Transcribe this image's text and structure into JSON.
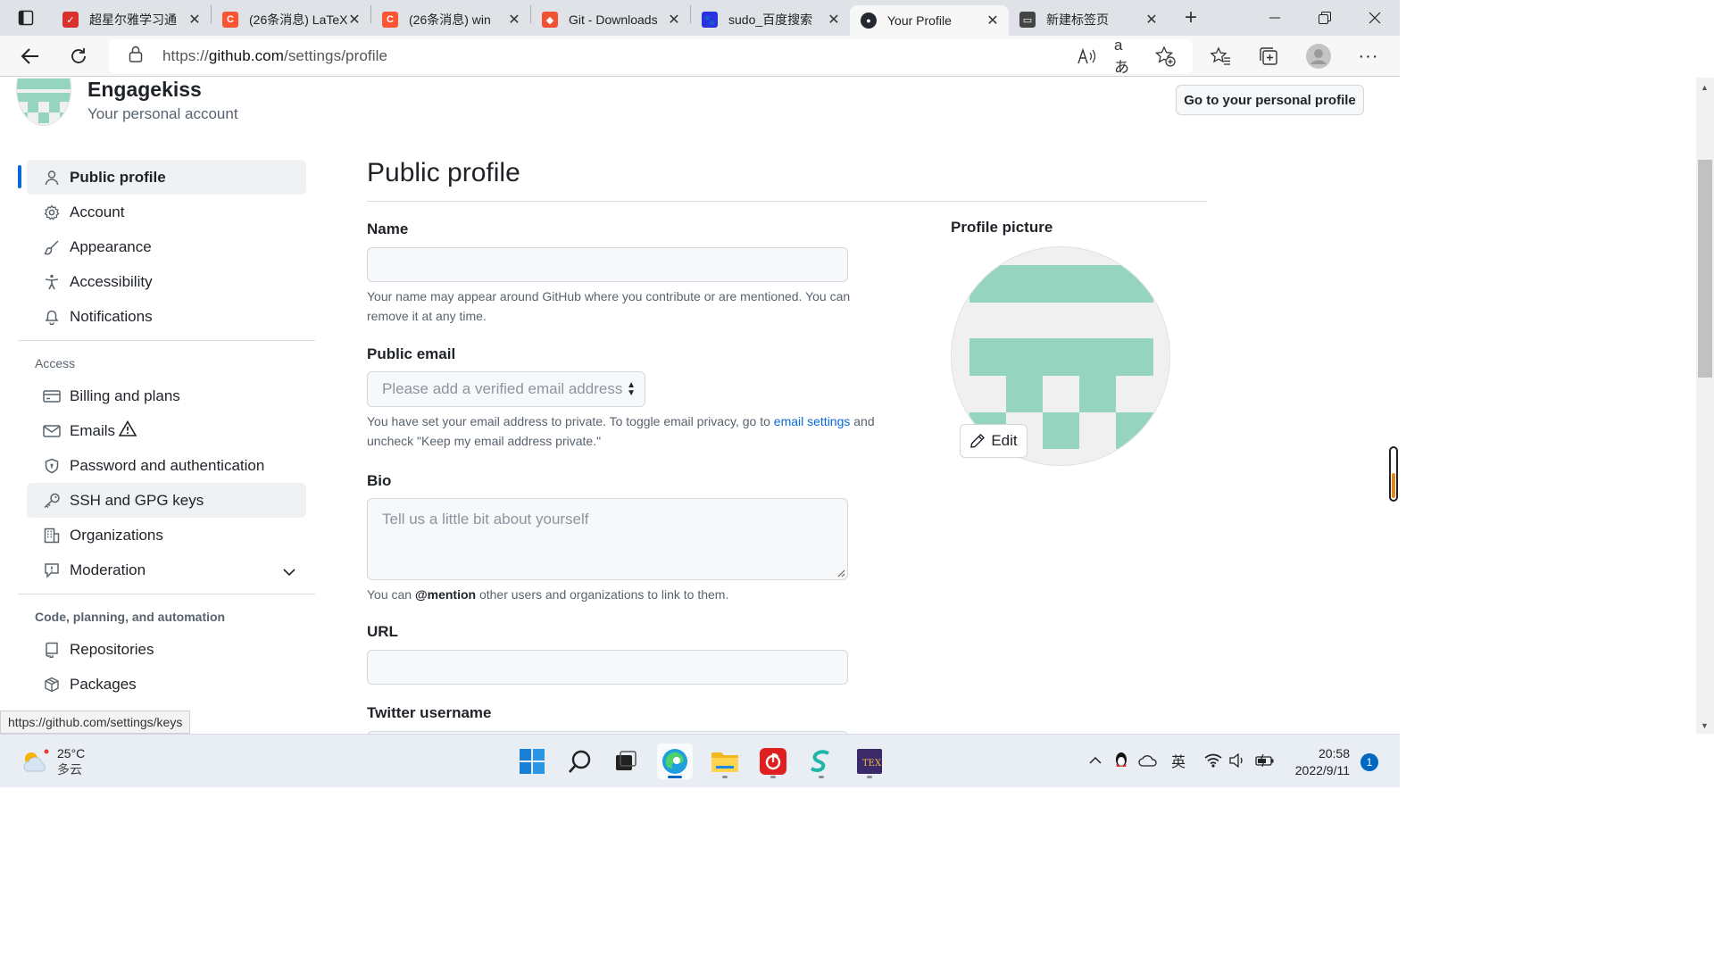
{
  "browser": {
    "tabs": [
      {
        "title": "超星尔雅学习通",
        "favicon_color": "#d9322e",
        "favicon_glyph": "✓"
      },
      {
        "title": "(26条消息) LaTeX",
        "favicon_color": "#fc5531",
        "favicon_glyph": "C"
      },
      {
        "title": "(26条消息) win",
        "favicon_color": "#fc5531",
        "favicon_glyph": "C"
      },
      {
        "title": "Git - Downloads",
        "favicon_color": "#f05133",
        "favicon_glyph": "◆"
      },
      {
        "title": "sudo_百度搜索",
        "favicon_color": "#2932e1",
        "favicon_glyph": "🐾"
      },
      {
        "title": "Your Profile",
        "favicon_color": "#24292f",
        "favicon_glyph": "●",
        "active": true
      },
      {
        "title": "新建标签页",
        "favicon_color": "#444444",
        "favicon_glyph": "▭"
      }
    ],
    "url_prefix": "https://",
    "url_host": "github.com",
    "url_path": "/settings/profile"
  },
  "account": {
    "name": "Engagekiss",
    "subtitle": "Your personal account",
    "goto_profile_label": "Go to your personal profile"
  },
  "sidebar": {
    "items_top": [
      {
        "label": "Public profile",
        "icon": "person-icon",
        "selected": true
      },
      {
        "label": "Account",
        "icon": "gear-icon"
      },
      {
        "label": "Appearance",
        "icon": "paintbrush-icon"
      },
      {
        "label": "Accessibility",
        "icon": "accessibility-icon"
      },
      {
        "label": "Notifications",
        "icon": "bell-icon"
      }
    ],
    "access_heading": "Access",
    "items_access": [
      {
        "label": "Billing and plans",
        "icon": "credit-card-icon"
      },
      {
        "label": "Emails",
        "icon": "mail-icon",
        "warning": true
      },
      {
        "label": "Password and authentication",
        "icon": "shield-icon"
      },
      {
        "label": "SSH and GPG keys",
        "icon": "key-icon",
        "hover": true
      },
      {
        "label": "Organizations",
        "icon": "organization-icon"
      },
      {
        "label": "Moderation",
        "icon": "report-icon",
        "expandable": true
      }
    ],
    "code_heading": "Code, planning, and automation",
    "items_code": [
      {
        "label": "Repositories",
        "icon": "repo-icon"
      },
      {
        "label": "Packages",
        "icon": "package-icon"
      }
    ]
  },
  "main": {
    "title": "Public profile",
    "name_label": "Name",
    "name_value": "",
    "name_help": "Your name may appear around GitHub where you contribute or are mentioned. You can remove it at any time.",
    "email_label": "Public email",
    "email_placeholder": "Please add a verified email address",
    "email_help_before": "You have set your email address to private. To toggle email privacy, go to ",
    "email_help_link": "email settings",
    "email_help_after": " and uncheck \"Keep my email address private.\"",
    "bio_label": "Bio",
    "bio_placeholder": "Tell us a little bit about yourself",
    "bio_help_before": "You can ",
    "bio_help_mention": "@mention",
    "bio_help_after": " other users and organizations to link to them.",
    "url_label": "URL",
    "url_value": "",
    "twitter_label": "Twitter username",
    "profile_picture_label": "Profile picture",
    "edit_label": "Edit"
  },
  "status_tip": "https://github.com/settings/keys",
  "taskbar": {
    "temperature": "25°C",
    "condition": "多云",
    "time": "20:58",
    "date": "2022/9/11",
    "ime": "英",
    "notification_count": "1"
  },
  "colors": {
    "accent": "#0969da",
    "identicon": "#95d5c0"
  }
}
